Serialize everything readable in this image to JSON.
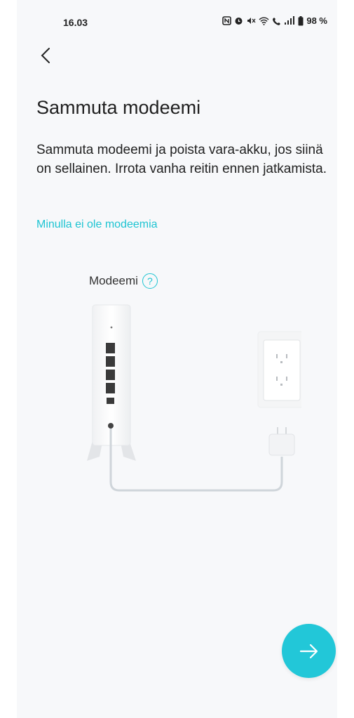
{
  "status_bar": {
    "time": "16.03",
    "battery": "98 %"
  },
  "page": {
    "title": "Sammuta modeemi",
    "description": "Sammuta modeemi ja poista vara-akku, jos siinä on sellainen. Irrota vanha reitin ennen jatkamista.",
    "no_modem_link": "Minulla ei ole modeemia",
    "modem_label": "Modeemi",
    "help_icon_glyph": "?"
  },
  "colors": {
    "accent": "#22c7d8",
    "background": "#f7f8fa"
  },
  "icons": {
    "back": "chevron-left-icon",
    "next": "arrow-right-icon",
    "help": "question-circle-icon"
  }
}
